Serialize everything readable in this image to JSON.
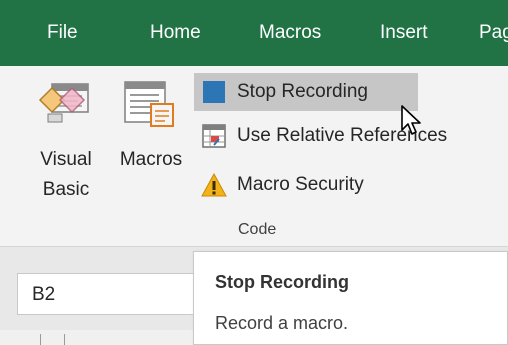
{
  "tabs": [
    {
      "label": "File"
    },
    {
      "label": "Home"
    },
    {
      "label": "Macros"
    },
    {
      "label": "Insert"
    },
    {
      "label": "Pag"
    }
  ],
  "ribbon": {
    "visual_basic": {
      "line1": "Visual",
      "line2": "Basic"
    },
    "macros": {
      "label": "Macros"
    },
    "stop_recording": {
      "label": "Stop Recording"
    },
    "use_relative_references": {
      "label": "Use Relative References"
    },
    "macro_security": {
      "label": "Macro Security"
    },
    "group_label": "Code"
  },
  "name_box": {
    "value": "B2"
  },
  "tooltip": {
    "title": "Stop Recording",
    "description": "Record a macro."
  },
  "colors": {
    "tab_bar": "#217346",
    "stop_square": "#2e75b6",
    "warning": "#f2b21b",
    "highlight": "#c6c6c6"
  },
  "icons": [
    "visual-basic-icon",
    "macros-icon",
    "stop-recording-icon",
    "relative-references-icon",
    "macro-security-icon",
    "mouse-pointer-icon"
  ]
}
